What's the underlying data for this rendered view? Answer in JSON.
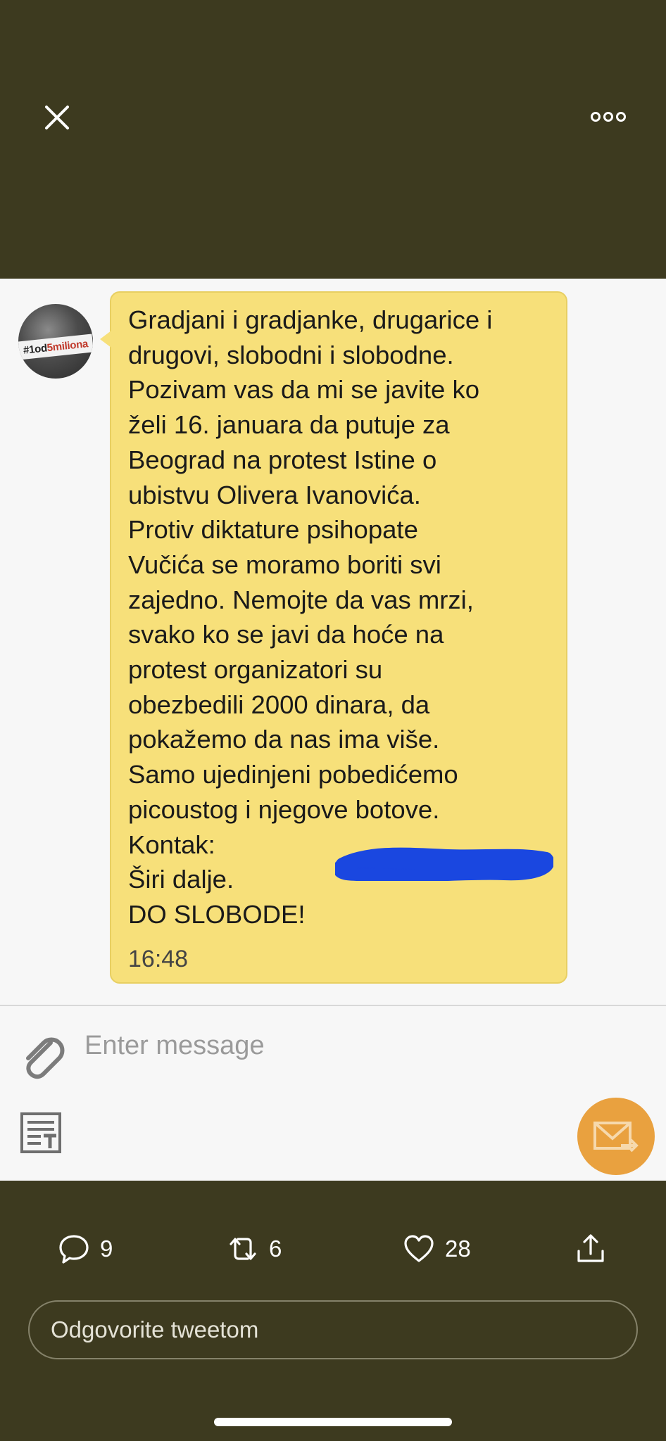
{
  "viewer": {
    "close_icon": "close-icon",
    "more_icon": "more-horizontal-icon"
  },
  "screenshot": {
    "avatar_text": "#1od5miliona",
    "message_lines": [
      "Gradjani i gradjanke, drugarice i",
      "drugovi, slobodni i slobodne.",
      "Pozivam vas da mi se javite ko",
      "želi 16. januara da putuje za",
      "Beograd na protest Istine o",
      "ubistvu Olivera Ivanovića.",
      "Protiv diktature psihopate",
      "Vučića se moramo boriti svi",
      "zajedno. Nemojte da vas mrzi,",
      "svako ko se javi da hoće na",
      "protest organizatori su",
      "obezbedili 2000 dinara, da",
      "pokažemo da nas ima više.",
      "Samo ujedinjeni pobedićemo",
      "picoustog i njegove botove.",
      "Kontak:",
      "Širi dalje.",
      "DO SLOBODE!"
    ],
    "time": "16:48",
    "input_placeholder": "Enter message",
    "bubble_color": "#f7e07a",
    "send_color": "#e9a13f",
    "redaction_color": "#1a47e0"
  },
  "tweet_actions": {
    "replies": "9",
    "retweets": "6",
    "likes": "28"
  },
  "reply": {
    "placeholder": "Odgovorite tweetom"
  }
}
